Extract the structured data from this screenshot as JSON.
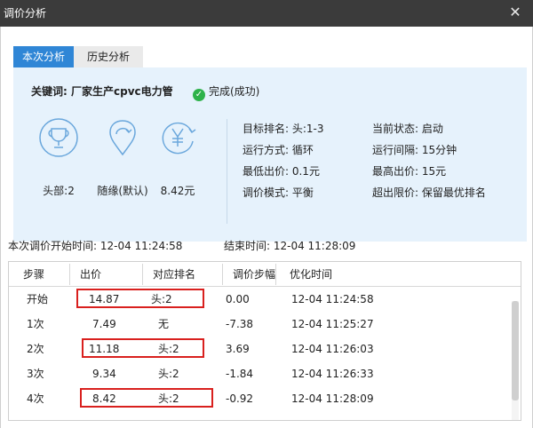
{
  "window": {
    "title": "调价分析",
    "close_glyph": "✕"
  },
  "tabs": [
    {
      "label": "本次分析"
    },
    {
      "label": "历史分析"
    }
  ],
  "summary": {
    "keyword_label": "关键词:",
    "keyword_value": "厂家生产cpvc电力管",
    "status_check_glyph": "✓",
    "status_text": "完成(成功)"
  },
  "stats": [
    {
      "icon": "trophy-icon",
      "label": "头部:2"
    },
    {
      "icon": "location-pin-icon",
      "label": "随缘(默认)"
    },
    {
      "icon": "yen-refresh-icon",
      "label": "8.42元"
    }
  ],
  "info_left": [
    "目标排名: 头:1-3",
    "运行方式: 循环",
    "最低出价: 0.1元",
    "调价模式: 平衡"
  ],
  "info_right": [
    "当前状态: 启动",
    "运行间隔: 15分钟",
    "最高出价: 15元",
    "超出限价: 保留最优排名"
  ],
  "times": {
    "start": "本次调价开始时间: 12-04 11:24:58",
    "end": "结束时间: 12-04 11:28:09"
  },
  "table": {
    "headers": [
      "步骤",
      "出价",
      "对应排名",
      "调价步幅",
      "优化时间"
    ],
    "rows": [
      {
        "step": "开始",
        "bid": "14.87",
        "rank": "头:2",
        "delta": "0.00",
        "time": "12-04 11:24:58",
        "highlight": true
      },
      {
        "step": "1次",
        "bid": "7.49",
        "rank": "无",
        "delta": "-7.38",
        "time": "12-04 11:25:27",
        "highlight": false
      },
      {
        "step": "2次",
        "bid": "11.18",
        "rank": "头:2",
        "delta": "3.69",
        "time": "12-04 11:26:03",
        "highlight": true
      },
      {
        "step": "3次",
        "bid": "9.34",
        "rank": "头:2",
        "delta": "-1.84",
        "time": "12-04 11:26:33",
        "highlight": false
      },
      {
        "step": "4次",
        "bid": "8.42",
        "rank": "头:2",
        "delta": "-0.92",
        "time": "12-04 11:28:09",
        "highlight": true
      }
    ]
  },
  "colors": {
    "accent": "#2f86d6",
    "panel_bg": "#e6f2fc",
    "icon_stroke": "#6aa7dc",
    "highlight_box": "#d9201e",
    "success": "#2eb24a"
  }
}
